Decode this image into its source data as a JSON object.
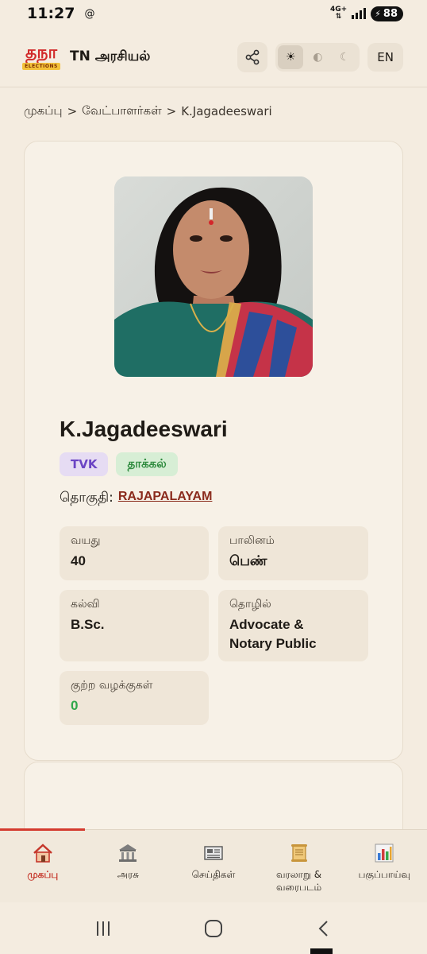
{
  "status_bar": {
    "time": "11:27",
    "extra_icon": "@",
    "network": "4G+",
    "battery": "88"
  },
  "header": {
    "logo_text": "தநா",
    "logo_sub": "ELECTIONS",
    "title": "TN அரசியல்",
    "lang": "EN",
    "theme_options": [
      "light",
      "system",
      "dark"
    ],
    "theme_selected": "light"
  },
  "breadcrumb": {
    "home": "முகப்பு",
    "separator1": ">",
    "candidates": "வேட்பாளர்கள்",
    "separator2": ">",
    "current": "K.Jagadeeswari"
  },
  "candidate": {
    "name": "K.Jagadeeswari",
    "party": "TVK",
    "status": "தாக்கல்",
    "constituency_label": "தொகுதி:",
    "constituency": "RAJAPALAYAM",
    "age_label": "வயது",
    "age": "40",
    "gender_label": "பாலினம்",
    "gender": "பெண்",
    "education_label": "கல்வி",
    "education": "B.Sc.",
    "occupation_label": "தொழில்",
    "occupation_line1": "Advocate &",
    "occupation_line2": "Notary Public",
    "cases_label": "குற்ற வழக்குகள்",
    "cases": "0"
  },
  "bottom_nav": {
    "items": [
      {
        "label": "முகப்பு",
        "icon": "home-icon"
      },
      {
        "label": "அரசு",
        "icon": "government-icon"
      },
      {
        "label": "செய்திகள்",
        "icon": "news-icon"
      },
      {
        "label_line1": "வரலாறு &",
        "label_line2": "வரைபடம்",
        "icon": "scroll-icon"
      },
      {
        "label": "பகுப்பாய்வு",
        "icon": "chart-icon"
      }
    ],
    "active_index": 0
  },
  "colors": {
    "background": "#f4ece0",
    "accent": "#c5362a",
    "party_tag": "#6b44c4",
    "status_tag": "#2e8b3e",
    "link": "#8a2a1c"
  }
}
